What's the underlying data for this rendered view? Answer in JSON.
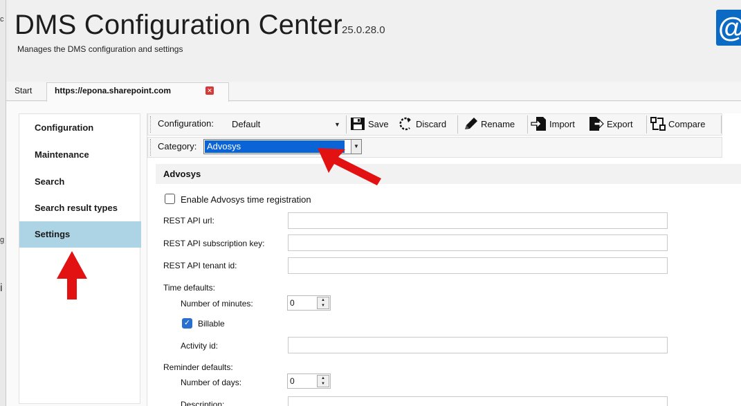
{
  "window": {
    "left_edge_fragments": [
      "c",
      "g",
      "i"
    ]
  },
  "header": {
    "title": "DMS Configuration Center",
    "version": "25.0.28.0",
    "subtitle": "Manages the DMS configuration and settings",
    "logo_glyph": "@"
  },
  "tabs": [
    {
      "label": "Start"
    },
    {
      "label": "https://epona.sharepoint.com",
      "close_glyph": "✕"
    }
  ],
  "sidebar": {
    "items": [
      {
        "label": "Configuration"
      },
      {
        "label": "Maintenance"
      },
      {
        "label": "Search"
      },
      {
        "label": "Search result types"
      },
      {
        "label": "Settings",
        "selected": true
      }
    ]
  },
  "toolbar": {
    "configuration_label": "Configuration:",
    "configuration_value": "Default",
    "save_label": "Save",
    "discard_label": "Discard",
    "rename_label": "Rename",
    "import_label": "Import",
    "export_label": "Export",
    "compare_label": "Compare"
  },
  "category": {
    "label": "Category:",
    "value": "Advosys"
  },
  "section": {
    "title": "Advosys"
  },
  "form": {
    "enable_label": "Enable Advosys time registration",
    "enable_checked": false,
    "rest_api_url_label": "REST API url:",
    "rest_api_url_value": "",
    "subscription_key_label": "REST API subscription key:",
    "subscription_key_value": "",
    "tenant_id_label": "REST API tenant id:",
    "tenant_id_value": "",
    "time_defaults_label": "Time defaults:",
    "minutes_label": "Number of minutes:",
    "minutes_value": "0",
    "billable_label": "Billable",
    "billable_checked": true,
    "activity_id_label": "Activity id:",
    "activity_id_value": "",
    "reminder_defaults_label": "Reminder defaults:",
    "days_label": "Number of days:",
    "days_value": "0",
    "description_label": "Description:",
    "description_value": ""
  },
  "colors": {
    "accent_blue": "#0a64d6",
    "selected_nav": "#acd4e4",
    "annotation_red": "#e31212",
    "logo_blue": "#0b6ac4"
  }
}
